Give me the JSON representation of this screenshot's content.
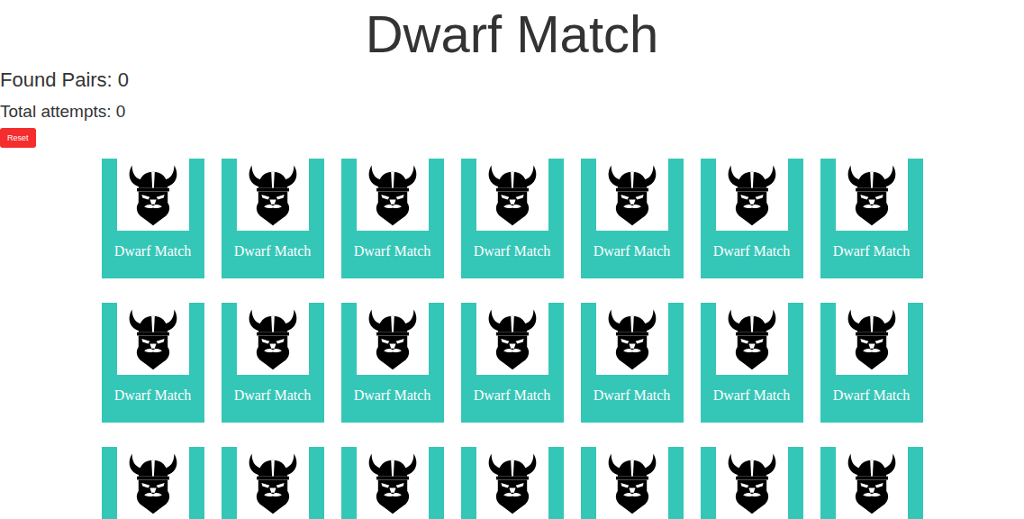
{
  "title": "Dwarf Match",
  "stats": {
    "found_pairs": "Found Pairs: 0",
    "total_attempts": "Total attempts: 0"
  },
  "reset_button": "Reset",
  "cards": [
    {
      "label": "Dwarf Match",
      "face_up": false
    },
    {
      "label": "Dwarf Match",
      "face_up": false
    },
    {
      "label": "Dwarf Match",
      "face_up": false
    },
    {
      "label": "Dwarf Match",
      "face_up": false
    },
    {
      "label": "Dwarf Match",
      "face_up": false
    },
    {
      "label": "Dwarf Match",
      "face_up": false
    },
    {
      "label": "Dwarf Match",
      "face_up": false
    },
    {
      "label": "Dwarf Match",
      "face_up": false
    },
    {
      "label": "Dwarf Match",
      "face_up": false
    },
    {
      "label": "Dwarf Match",
      "face_up": false
    },
    {
      "label": "Dwarf Match",
      "face_up": false
    },
    {
      "label": "Dwarf Match",
      "face_up": false
    },
    {
      "label": "Dwarf Match",
      "face_up": false
    },
    {
      "label": "Dwarf Match",
      "face_up": false
    },
    {
      "face_up": false
    },
    {
      "face_up": false
    },
    {
      "face_up": false
    },
    {
      "face_up": false
    },
    {
      "face_up": false
    },
    {
      "face_up": false
    },
    {
      "face_up": false
    }
  ]
}
